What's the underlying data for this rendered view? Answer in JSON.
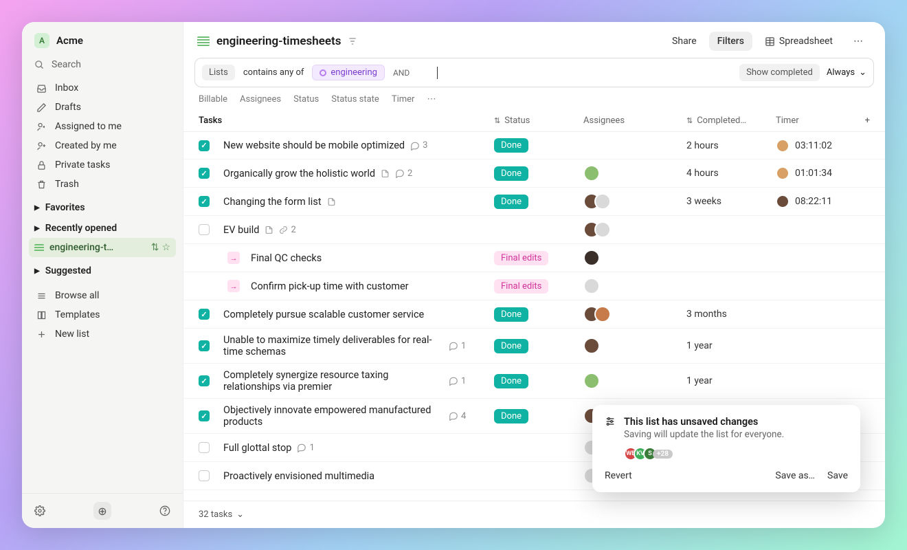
{
  "workspace": {
    "initial": "A",
    "name": "Acme"
  },
  "sidebar": {
    "search": "Search",
    "nav": [
      {
        "icon": "tray",
        "label": "Inbox"
      },
      {
        "icon": "pencil",
        "label": "Drafts"
      },
      {
        "icon": "user-arrow",
        "label": "Assigned to me"
      },
      {
        "icon": "user-plus",
        "label": "Created by me"
      },
      {
        "icon": "lock",
        "label": "Private tasks"
      },
      {
        "icon": "trash",
        "label": "Trash"
      }
    ],
    "sections": {
      "favorites": "Favorites",
      "recent": "Recently opened",
      "current_list": "engineering-t…",
      "suggested": "Suggested"
    },
    "bottom": [
      {
        "icon": "grid",
        "label": "Browse all"
      },
      {
        "icon": "book",
        "label": "Templates"
      },
      {
        "icon": "plus",
        "label": "New list"
      }
    ]
  },
  "header": {
    "list_name": "engineering-timesheets",
    "share": "Share",
    "filters": "Filters",
    "spreadsheet": "Spreadsheet"
  },
  "filter": {
    "field": "Lists",
    "op": "contains any of",
    "tag": "engineering",
    "join": "AND",
    "show_completed": "Show completed",
    "always": "Always",
    "sub": [
      "Billable",
      "Assignees",
      "Status",
      "Status state",
      "Timer"
    ]
  },
  "columns": {
    "tasks": "Tasks",
    "status": "Status",
    "assignees": "Assignees",
    "completed": "Completed…",
    "timer": "Timer"
  },
  "rows": [
    {
      "done": true,
      "title": "New website should be mobile optimized",
      "comments": "3",
      "status": "Done",
      "avatars": [],
      "completed": "2 hours",
      "timer": "03:11:02",
      "timer_av": "#d9a066"
    },
    {
      "done": true,
      "title": "Organically grow the holistic world",
      "comments": "2",
      "doc": true,
      "status": "Done",
      "avatars": [
        "#8bbf6f"
      ],
      "completed": "4 hours",
      "timer": "01:01:34",
      "timer_av": "#d9a066"
    },
    {
      "done": true,
      "title": "Changing the form list",
      "doc": true,
      "status": "Done",
      "avatars": [
        "#6b4c3b",
        "#d9d9d9"
      ],
      "completed": "3 weeks",
      "timer": "08:22:11",
      "timer_av": "#6b4c3b"
    },
    {
      "done": false,
      "title": "EV build",
      "doc": true,
      "sublinks": "2",
      "avatars": [
        "#6b4c3b",
        "#d9d9d9"
      ]
    },
    {
      "subtask": true,
      "title": "Final QC checks",
      "status": "Final edits",
      "edits": true,
      "avatars": [
        "#3b2f2a"
      ]
    },
    {
      "subtask": true,
      "title": "Confirm pick-up time with customer",
      "status": "Final edits",
      "edits": true,
      "avatars": [
        "#d9d9d9"
      ]
    },
    {
      "done": true,
      "title": "Completely pursue scalable customer service",
      "status": "Done",
      "avatars": [
        "#6b4c3b",
        "#c77b4a"
      ],
      "completed": "3 months"
    },
    {
      "done": true,
      "twoLine": true,
      "title": "Unable to maximize timely deliverables for real-time schemas",
      "comments": "1",
      "status": "Done",
      "avatars": [
        "#6b4c3b"
      ],
      "completed": "1 year"
    },
    {
      "done": true,
      "twoLine": true,
      "title": "Completely synergize resource taxing relationships via premier",
      "comments": "1",
      "status": "Done",
      "avatars": [
        "#8bbf6f"
      ],
      "completed": "1 year"
    },
    {
      "done": true,
      "twoLine": true,
      "title": "Objectively innovate empowered manufactured products",
      "comments": "4",
      "status": "Done",
      "avatars": [
        "#6b4c3b"
      ]
    },
    {
      "done": false,
      "title": "Full glottal stop",
      "comments": "1",
      "avatars": [
        "#d9d9d9"
      ]
    },
    {
      "done": false,
      "title": "Proactively envisioned multimedia",
      "avatars": [
        "#d9d9d9"
      ]
    }
  ],
  "footer": {
    "count": "32 tasks"
  },
  "popover": {
    "title": "This list has unsaved changes",
    "subtitle": "Saving will update the list for everyone.",
    "extra": "+28",
    "revert": "Revert",
    "save_as": "Save as…",
    "save": "Save"
  }
}
